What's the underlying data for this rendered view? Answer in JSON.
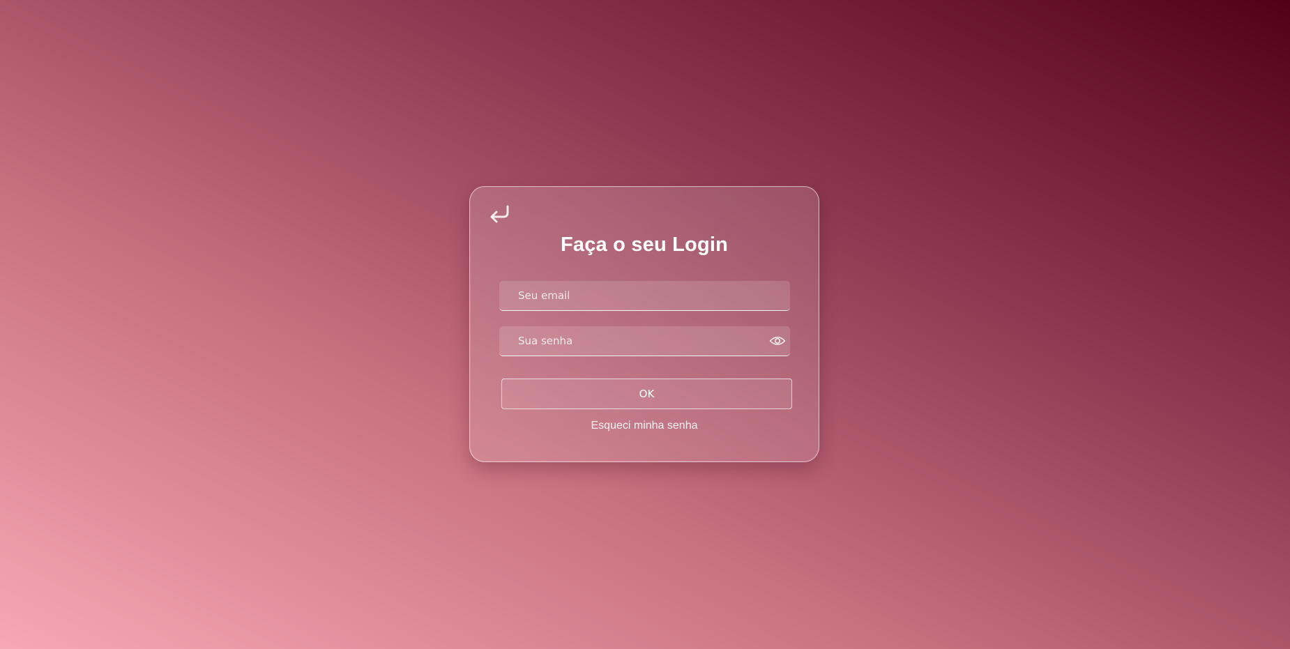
{
  "login": {
    "title": "Faça o seu Login",
    "back_icon": "back-arrow-icon",
    "email": {
      "placeholder": "Seu email",
      "value": ""
    },
    "password": {
      "placeholder": "Sua senha",
      "value": "",
      "toggle_icon": "eye-icon"
    },
    "ok_label": "OK",
    "forgot_label": "Esqueci minha senha"
  },
  "colors": {
    "background_light": "#f7a8b4",
    "background_mid": "#c8717f",
    "background_dark": "#520018",
    "text": "#ffffff"
  }
}
